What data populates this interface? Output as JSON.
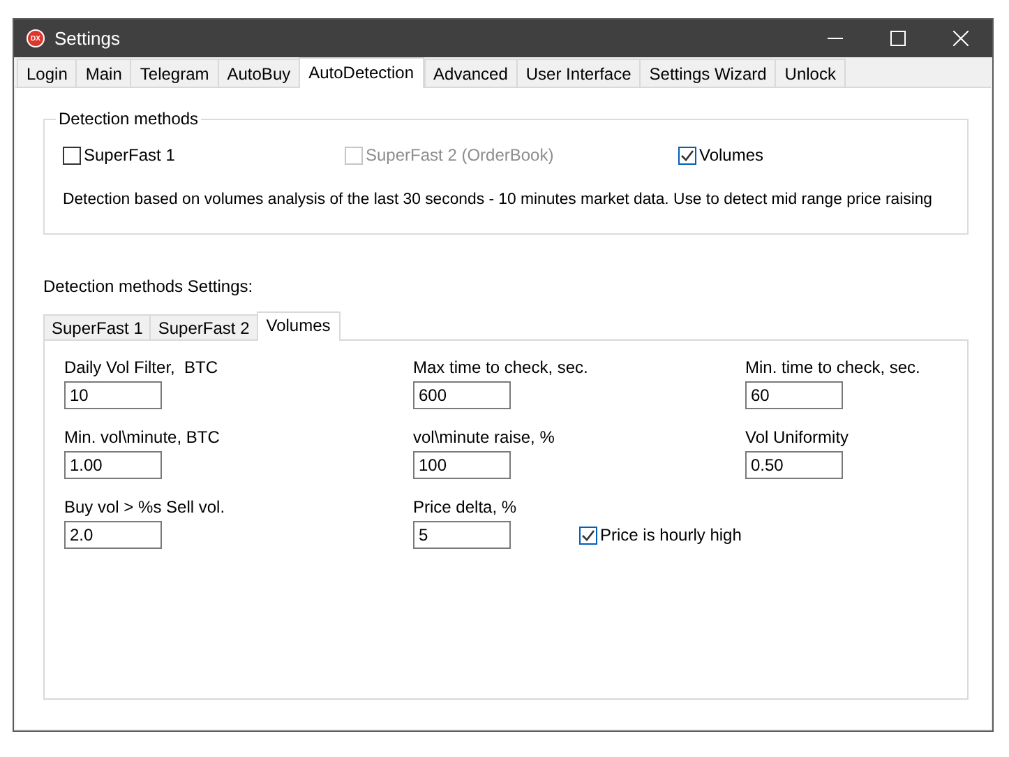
{
  "window": {
    "logo": "DX",
    "title": "Settings"
  },
  "tabs": [
    {
      "label": "Login",
      "selected": false
    },
    {
      "label": "Main",
      "selected": false
    },
    {
      "label": "Telegram",
      "selected": false
    },
    {
      "label": "AutoBuy",
      "selected": false
    },
    {
      "label": "AutoDetection",
      "selected": true
    },
    {
      "label": "Advanced",
      "selected": false
    },
    {
      "label": "User Interface",
      "selected": false
    },
    {
      "label": "Settings Wizard",
      "selected": false
    },
    {
      "label": "Unlock",
      "selected": false
    }
  ],
  "detection_methods": {
    "title": "Detection methods",
    "methods": [
      {
        "label": "SuperFast 1",
        "checked": false,
        "disabled": false
      },
      {
        "label": "SuperFast 2 (OrderBook)",
        "checked": false,
        "disabled": true
      },
      {
        "label": "Volumes",
        "checked": true,
        "disabled": false
      }
    ],
    "description": "Detection based on volumes analysis of the last 30 seconds - 10 minutes market data. Use to detect mid range price raising"
  },
  "settings_heading": "Detection methods Settings:",
  "settings_tabs": [
    {
      "label": "SuperFast 1",
      "selected": false
    },
    {
      "label": "SuperFast 2",
      "selected": false
    },
    {
      "label": "Volumes",
      "selected": true
    }
  ],
  "rows": [
    [
      {
        "kind": "field",
        "label": "Daily Vol Filter,  BTC",
        "value": "10"
      },
      {
        "kind": "field",
        "label": "Max time to check, sec.",
        "value": "600"
      },
      {
        "kind": "field",
        "label": "Min. time to check, sec.",
        "value": "60"
      }
    ],
    [
      {
        "kind": "field",
        "label": "Min. vol\\minute, BTC",
        "value": "1.00"
      },
      {
        "kind": "field",
        "label": "vol\\minute raise, %",
        "value": "100"
      },
      {
        "kind": "field",
        "label": "Vol Uniformity",
        "value": "0.50"
      }
    ],
    [
      {
        "kind": "field",
        "label": "Buy vol > %s Sell vol.",
        "value": "2.0"
      },
      {
        "kind": "field",
        "label": "Price delta, %",
        "value": "5"
      },
      {
        "kind": "checkbox",
        "label": "Price is hourly high",
        "checked": true
      }
    ]
  ]
}
